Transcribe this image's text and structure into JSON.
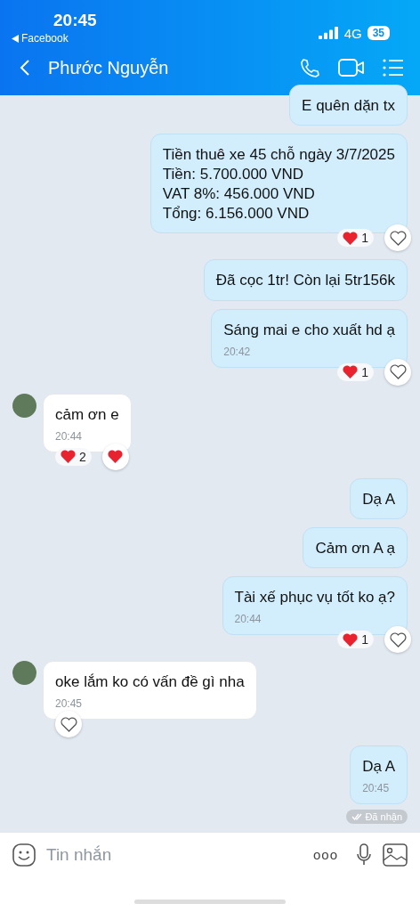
{
  "status_bar": {
    "time": "20:45",
    "back_app": "Facebook",
    "network": "4G",
    "battery": "35"
  },
  "header": {
    "title": "Phước Nguyễn"
  },
  "messages": [
    {
      "kind": "sent",
      "text": "E quên dặn tx"
    },
    {
      "kind": "sent",
      "text": "Tiền thuê xe 45 chỗ ngày 3/7/2025\nTiền: 5.700.000 VND\nVAT 8%: 456.000 VND\nTổng: 6.156.000 VND",
      "reaction_count": "1",
      "liked": false
    },
    {
      "kind": "sent",
      "text": "Đã cọc 1tr! Còn lại 5tr156k"
    },
    {
      "kind": "sent",
      "text": "Sáng mai e cho xuất hd ạ",
      "time": "20:42",
      "reaction_count": "1",
      "liked": false
    },
    {
      "kind": "received",
      "text": "cảm ơn e",
      "time": "20:44",
      "reaction_count": "2",
      "liked": true
    },
    {
      "kind": "sent",
      "text": "Dạ A"
    },
    {
      "kind": "sent",
      "text": "Cảm ơn A ạ"
    },
    {
      "kind": "sent",
      "text": "Tài xế phục vụ tốt ko ạ?",
      "time": "20:44",
      "reaction_count": "1",
      "liked": false
    },
    {
      "kind": "received",
      "text": "oke lắm ko có vấn đề gì nha",
      "time": "20:45",
      "liked": false
    },
    {
      "kind": "sent",
      "text": "Dạ A",
      "time": "20:45"
    }
  ],
  "receipt": "Đã nhận",
  "composer": {
    "placeholder": "Tin nhắn",
    "more": "ooo"
  }
}
